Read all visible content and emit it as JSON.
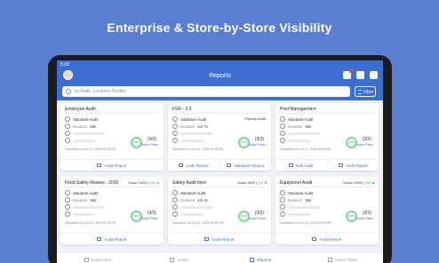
{
  "headline": "Enterprise & Store-by-Store Visibility",
  "status": {
    "time": "5:30"
  },
  "header": {
    "title": "Reports"
  },
  "search": {
    "placeholder": "by Audit, Location, Auditor",
    "filter_label": "Filter"
  },
  "cards": [
    {
      "title": "Employee Audit",
      "type": "Standard Audit",
      "duration_label": "Duration",
      "duration": "28s",
      "ring": "100%",
      "count": "(3/3)",
      "action": "Action Plans",
      "submitted": "Submitted on Oct 11, 2023 06:28 PM",
      "buttons": [
        "Audit Report"
      ]
    },
    {
      "title": "FSR - 2.0",
      "type": "Validation Audit",
      "primary": "Primary Audit",
      "duration_label": "Duration",
      "duration": "1m 7s",
      "ring": "100%",
      "count": "(3/3)",
      "action": "Action Plans",
      "submitted": "Submitted on Oct 11, 2023 06:28 PM",
      "buttons": [
        "Audit Report",
        "Validation Report"
      ]
    },
    {
      "title": "Pest Management",
      "type": "Standard Audit",
      "duration_label": "Duration",
      "duration": "48s",
      "ring": "100%",
      "count": "(3/3)",
      "action": "Action Plans",
      "submitted": "Submitted on Oct 11, 2023 06:28 PM",
      "buttons": [
        "Edit Audit",
        "Audit Report"
      ]
    },
    {
      "title": "Food Safety Review - 2020",
      "score_label": "Score 100%",
      "score_change": "3%",
      "score_dir": "up",
      "type": "Standard Audit",
      "duration_label": "Duration",
      "duration": "30s",
      "ring": "100%",
      "count": "(3/3)",
      "action": "Action Plans",
      "submitted": "Submitted on Oct 04, 2023 05:28 PM",
      "buttons": [
        "Audit Report"
      ]
    },
    {
      "title": "Safety Audit form",
      "score_label": "Score 95%",
      "score_change": "1%",
      "score_dir": "down",
      "type": "Standard Audit",
      "duration_label": "Duration",
      "duration": "1m 2s",
      "ring": "100%",
      "count": "(3/3)",
      "action": "Action Plans",
      "submitted": "Submitted on Oct 04, 2023 05:28 PM",
      "buttons": [
        "Audit Report"
      ]
    },
    {
      "title": "Equipment Audit",
      "score_label": "Score 100%",
      "score_change": "3%",
      "score_dir": "up",
      "type": "Standard Audit",
      "duration_label": "Duration",
      "duration": "39s",
      "ring": "100%",
      "count": "(3/3)",
      "action": "Action Plans",
      "submitted": "Submitted on Oct 04, 2023 05:28 PM",
      "buttons": [
        "Audit Report"
      ]
    }
  ],
  "nav": {
    "items": [
      "Dashboard",
      "Audits",
      "Reports",
      "Action Plans"
    ],
    "active": "Reports"
  },
  "colors": {
    "background": "#5b7fd0",
    "primary": "#3d6fd0",
    "success": "#2eaa4c",
    "danger": "#e74c3c"
  }
}
